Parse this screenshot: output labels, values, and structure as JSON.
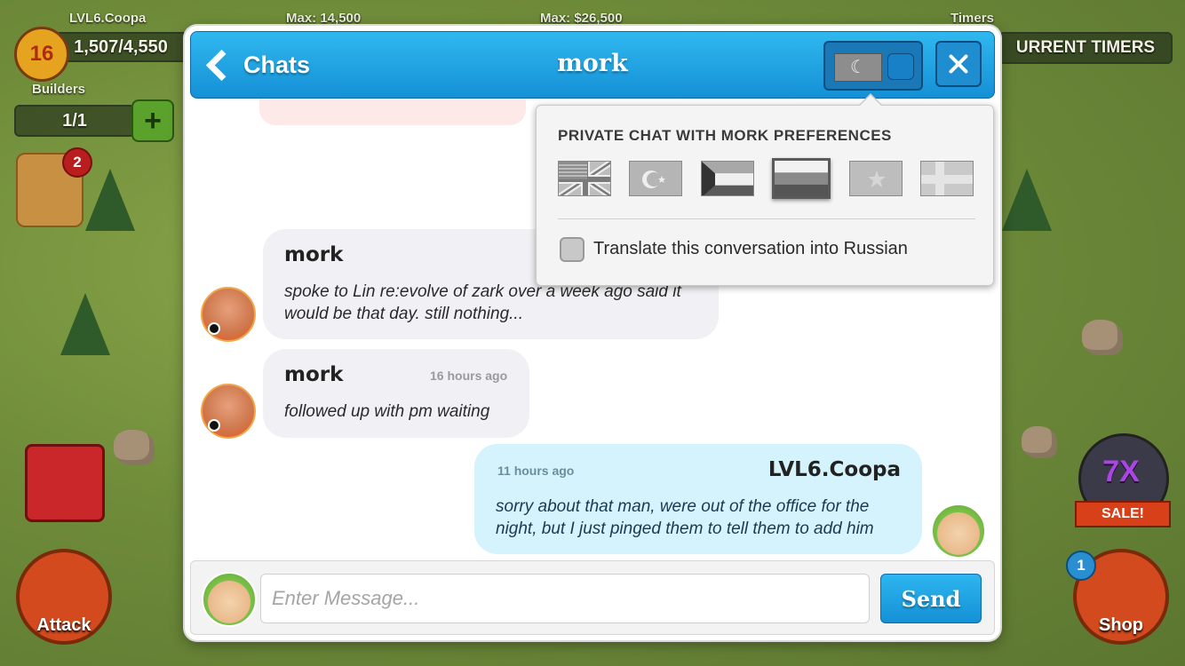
{
  "background": {
    "player_name": "LVL6.Coopa",
    "level": "16",
    "xp": "1,507/4,550",
    "builders_label": "Builders",
    "builders_count": "1/1",
    "max_gold": "Max: 14,500",
    "max_cash": "Max: $26,500",
    "timers_label": "Timers",
    "timers_button": "URRENT TIMERS",
    "hero_notification": "2",
    "attack_label": "Attack",
    "shop_label": "Shop",
    "shop_notification": "1",
    "sale_multiplier": "7X",
    "sale_label": "SALE!"
  },
  "header": {
    "back_label": "Chats",
    "title": "mork"
  },
  "preferences": {
    "title": "PRIVATE CHAT WITH MORK PREFERENCES",
    "flags": [
      "us-flag",
      "turkey-flag",
      "kuwait-flag",
      "russia-flag",
      "vietnam-flag",
      "finland-flag"
    ],
    "selected_flag": "russia-flag",
    "translate_label": "Translate this conversation into Russian",
    "translate_checked": false
  },
  "messages": [
    {
      "sender": "mork",
      "time": "",
      "text": "spoke to Lin re:evolve of zark over a week ago said it would be that day. still nothing..."
    },
    {
      "sender": "mork",
      "time": "16 hours ago",
      "text": "followed up with pm waiting"
    },
    {
      "sender": "LVL6.Coopa",
      "time": "11 hours ago",
      "text": "sorry about that man, were out of the office for the night, but I just pinged them to tell them to add him"
    }
  ],
  "input": {
    "placeholder": "Enter Message...",
    "send_label": "Send"
  },
  "colors": {
    "header_blue": "#1fa3e4",
    "my_bubble": "#d4f3fc",
    "their_bubble": "#f1f1f5"
  }
}
